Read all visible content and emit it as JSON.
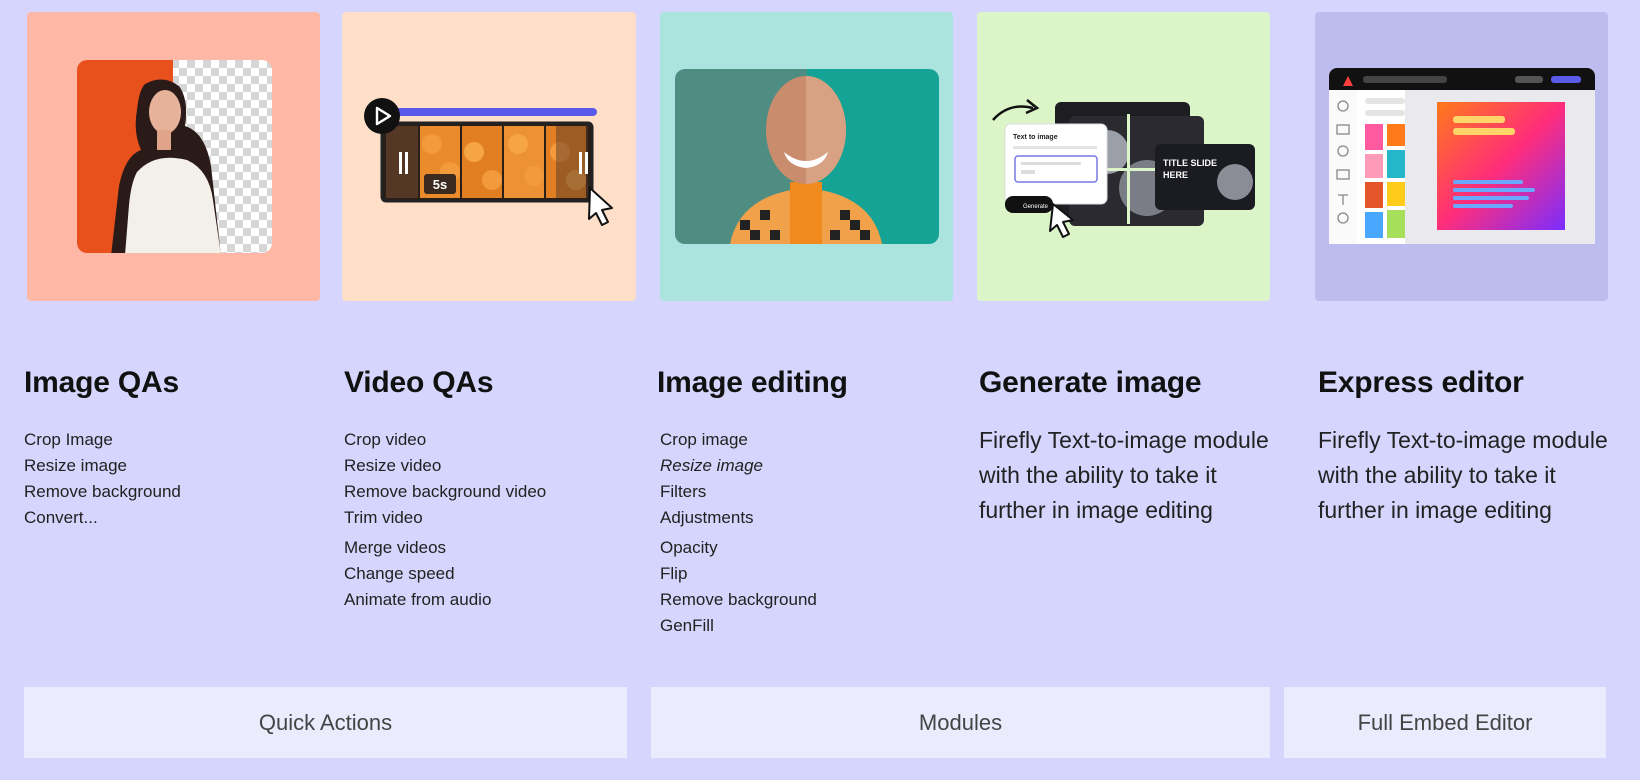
{
  "columns": [
    {
      "title": "Image QAs",
      "items": [
        "Crop Image",
        "Resize image",
        "Remove background",
        "Convert..."
      ],
      "card_color": "#ffb8a6"
    },
    {
      "title": "Video QAs",
      "items": [
        "Crop video",
        "Resize video",
        "Remove background video",
        "Trim video",
        "Merge videos",
        "Change speed",
        "Animate from audio"
      ],
      "card_color": "#ffdfc7",
      "video_badge": "5s"
    },
    {
      "title": "Image editing",
      "items": [
        "Crop image",
        "Resize image",
        "Filters",
        "Adjustments",
        "Opacity",
        "Flip",
        "Remove background",
        "GenFill"
      ],
      "card_color": "#abe3df"
    },
    {
      "title": "Generate image",
      "description": "Firefly Text-to-image module with the ability to take it further in image editing",
      "card_color": "#dbf5c8",
      "mock": {
        "panel_title": "Text to image",
        "generate_label": "Generate",
        "slide_text_1": "TITLE SLIDE",
        "slide_text_2": "HERE"
      }
    },
    {
      "title": "Express editor",
      "description": "Firefly Text-to-image module with the ability to take it further in image editing",
      "card_color": "#bcbcef"
    }
  ],
  "footer": {
    "quick_actions": "Quick Actions",
    "modules": "Modules",
    "full_embed_editor": "Full Embed Editor"
  },
  "colors": {
    "background": "#d5d5fd",
    "footer_button": "#ebebfe",
    "accent_blue": "#5b5bea"
  }
}
